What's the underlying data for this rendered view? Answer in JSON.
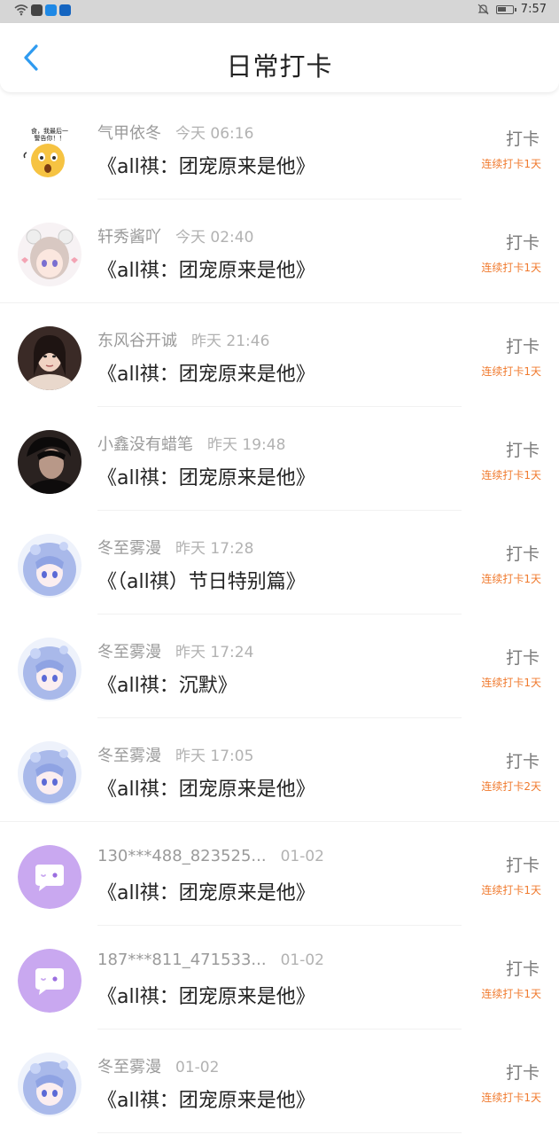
{
  "status_bar": {
    "time": "7:57",
    "left_icons": [
      "wifi-icon",
      "app-icon-1",
      "app-icon-2",
      "app-icon-3"
    ],
    "right_icons": [
      "mute-icon",
      "battery-icon"
    ]
  },
  "header": {
    "title": "日常打卡",
    "back_icon": "chevron-left-icon",
    "accent_color": "#2f9bf0"
  },
  "entries": [
    {
      "user": "气甲依冬",
      "time": "今天 06:16",
      "book": "《all祺：团宠原来是他》",
      "action": "打卡",
      "streak": "连续打卡1天",
      "avatar": "emoji-surprised"
    },
    {
      "user": "轩秀酱吖",
      "time": "今天 02:40",
      "book": "《all祺：团宠原来是他》",
      "action": "打卡",
      "streak": "连续打卡1天",
      "avatar": "anime-girl-white-hair"
    },
    {
      "user": "东风谷开诚",
      "time": "昨天 21:46",
      "book": "《all祺：团宠原来是他》",
      "action": "打卡",
      "streak": "连续打卡1天",
      "avatar": "photo-girl"
    },
    {
      "user": "小鑫没有蜡笔",
      "time": "昨天 19:48",
      "book": "《all祺：团宠原来是他》",
      "action": "打卡",
      "streak": "连续打卡1天",
      "avatar": "photo-boy"
    },
    {
      "user": "冬至雾漫",
      "time": "昨天 17:28",
      "book": "《（all祺）节日特别篇》",
      "action": "打卡",
      "streak": "连续打卡1天",
      "avatar": "anime-girl-blue-hair"
    },
    {
      "user": "冬至雾漫",
      "time": "昨天 17:24",
      "book": "《all祺：沉默》",
      "action": "打卡",
      "streak": "连续打卡1天",
      "avatar": "anime-girl-blue-hair"
    },
    {
      "user": "冬至雾漫",
      "time": "昨天 17:05",
      "book": "《all祺：团宠原来是他》",
      "action": "打卡",
      "streak": "连续打卡2天",
      "avatar": "anime-girl-blue-hair"
    },
    {
      "user": "130***488_823525...",
      "time": "01-02",
      "book": "《all祺：团宠原来是他》",
      "action": "打卡",
      "streak": "连续打卡1天",
      "avatar": "default-chat-bubble"
    },
    {
      "user": "187***811_471533...",
      "time": "01-02",
      "book": "《all祺：团宠原来是他》",
      "action": "打卡",
      "streak": "连续打卡1天",
      "avatar": "default-chat-bubble"
    },
    {
      "user": "冬至雾漫",
      "time": "01-02",
      "book": "《all祺：团宠原来是他》",
      "action": "打卡",
      "streak": "连续打卡1天",
      "avatar": "anime-girl-blue-hair"
    }
  ],
  "colors": {
    "streak": "#f07a2e",
    "username": "#9a9a9a",
    "default_avatar": "#c9a8f0"
  }
}
